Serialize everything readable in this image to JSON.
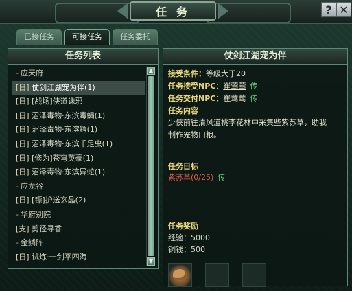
{
  "window": {
    "title": "任务",
    "help_icon": "?",
    "close_icon": "✕"
  },
  "tabs": [
    {
      "label": "已接任务",
      "active": false
    },
    {
      "label": "可接任务",
      "active": true
    },
    {
      "label": "任务委托",
      "active": false
    }
  ],
  "list_panel": {
    "title": "任务列表",
    "rows": [
      {
        "type": "group",
        "text": "应天府"
      },
      {
        "type": "quest",
        "tag": "[日]",
        "text": "仗剑江湖宠为伴(1)",
        "selected": true
      },
      {
        "type": "quest",
        "tag": "[日]",
        "text": "[战场]侠道诛邪"
      },
      {
        "type": "quest",
        "tag": "[日]",
        "text": "沼泽毒物·东滨毒蝎(1)"
      },
      {
        "type": "quest",
        "tag": "[日]",
        "text": "沼泽毒物·东滨鳄(1)"
      },
      {
        "type": "quest",
        "tag": "[日]",
        "text": "沼泽毒物·东滨千足虫(1)"
      },
      {
        "type": "quest",
        "tag": "[日]",
        "text": "[修为]苍穹英豪(1)"
      },
      {
        "type": "quest",
        "tag": "[日]",
        "text": "沼泽毒物·东滨异蛇(1)"
      },
      {
        "type": "group",
        "text": "应龙谷"
      },
      {
        "type": "quest",
        "tag": "[日]",
        "text": "[镖]护送玄晶(2)"
      },
      {
        "type": "group",
        "text": "华府别院"
      },
      {
        "type": "quest",
        "tag": "[支]",
        "text": "剪径寻香"
      },
      {
        "type": "group",
        "text": "金鳞阵"
      },
      {
        "type": "quest",
        "tag": "[日]",
        "text": "试炼·一剑平四海"
      }
    ]
  },
  "detail_panel": {
    "title": "仗剑江湖宠为伴",
    "accept_condition_label": "接受条件：",
    "accept_condition_value": "等级大于20",
    "accept_npc_label": "任务接受NPC：",
    "accept_npc_name": "崔莺莺",
    "submit_npc_label": "任务交付NPC：",
    "submit_npc_name": "崔莺莺",
    "teleport_label": "传",
    "content_label": "任务内容",
    "content_text": "少侠前往清风道桃李花林中采集些紫苏草，助我制作宠物口粮。",
    "goal_label": "任务目标",
    "goal_item": "紫苏草",
    "goal_count": "(0/25)",
    "reward_label": "任务奖励",
    "exp_label": "经验：",
    "exp_value": "5000",
    "coin_label": "铜钱：",
    "coin_value": "500"
  },
  "colors": {
    "accent_yellow": "#e8d67a",
    "target_red": "#e05a4a",
    "teleport_green": "#5fd47a"
  }
}
